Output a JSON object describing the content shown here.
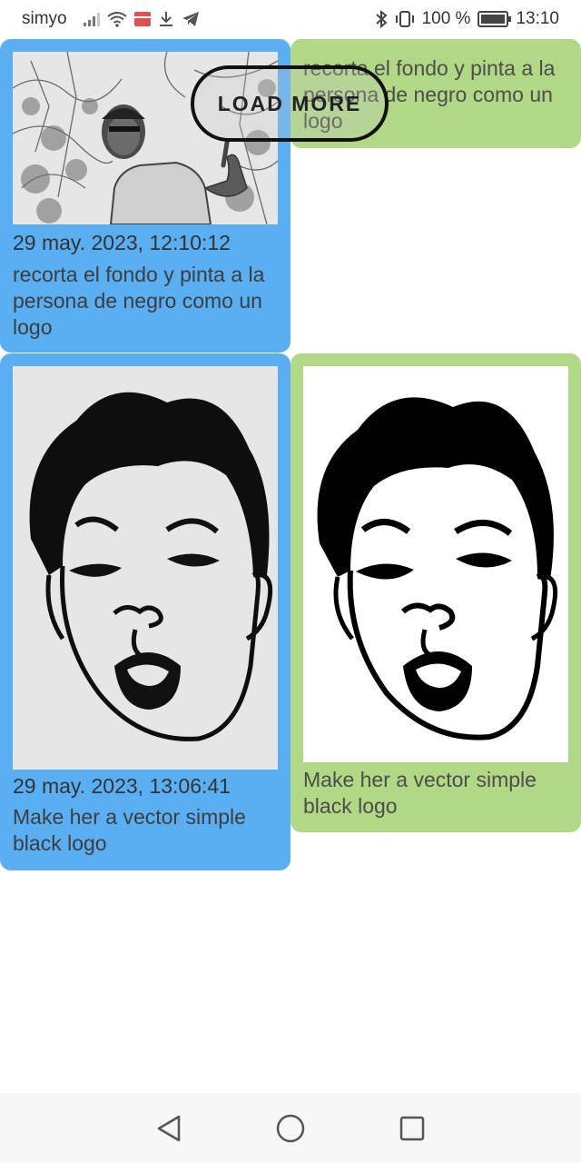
{
  "status_bar": {
    "carrier": "simyo",
    "battery": "100 %",
    "battery_level": 1.0,
    "time": "13:10",
    "icons": [
      "signal-icon",
      "wifi-icon",
      "gift-icon",
      "download-icon",
      "telegram-icon",
      "bluetooth-icon",
      "vibrate-icon",
      "battery-icon"
    ]
  },
  "load_more": {
    "label": "LOAD MORE"
  },
  "messages": [
    {
      "side": "user",
      "color": "#5aaff3",
      "image": "photo-icon",
      "timestamp": "29 may. 2023, 12:10:12",
      "text": "recorta el fondo y pinta a la persona de negro como un logo"
    },
    {
      "side": "bot",
      "color": "#b1d884",
      "text": "recorta el fondo y pinta a la persona de negro como un logo"
    },
    {
      "side": "user",
      "color": "#5aaff3",
      "image": "face-drawing-icon",
      "timestamp": "29 may. 2023, 13:06:41",
      "text": "Make her a vector simple black logo"
    },
    {
      "side": "bot",
      "color": "#b1d884",
      "image": "face-logo-icon",
      "text": "Make her a vector simple black logo"
    }
  ],
  "nav_bar": {
    "buttons": [
      "back-icon",
      "home-icon",
      "recents-icon"
    ]
  }
}
